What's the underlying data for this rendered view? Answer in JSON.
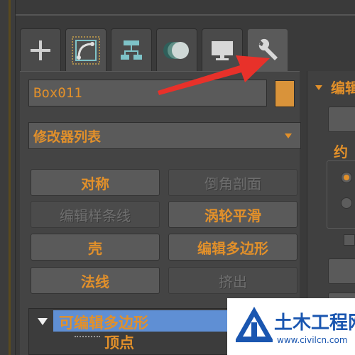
{
  "object_name": "Box011",
  "modifier_list_label": "修改器列表",
  "tabs": [
    {
      "name": "create-tab",
      "icon": "plus-icon"
    },
    {
      "name": "modify-tab",
      "icon": "modify-curve-icon"
    },
    {
      "name": "hierarchy-tab",
      "icon": "hierarchy-icon"
    },
    {
      "name": "motion-tab",
      "icon": "motion-circles-icon"
    },
    {
      "name": "display-tab",
      "icon": "monitor-icon"
    },
    {
      "name": "utilities-tab",
      "icon": "wrench-icon"
    }
  ],
  "modifier_buttons": [
    {
      "label": "对称",
      "enabled": true
    },
    {
      "label": "倒角剖面",
      "enabled": false
    },
    {
      "label": "编辑样条线",
      "enabled": false
    },
    {
      "label": "涡轮平滑",
      "enabled": true
    },
    {
      "label": "壳",
      "enabled": true
    },
    {
      "label": "编辑多边形",
      "enabled": true
    },
    {
      "label": "法线",
      "enabled": true
    },
    {
      "label": "挤出",
      "enabled": false
    }
  ],
  "stack": {
    "top_item": "可编辑多边形",
    "sub_item": "顶点"
  },
  "right_panel": {
    "rollout_title": "编辑",
    "label2": "约"
  },
  "watermark": {
    "title": "土木工程网",
    "url": "www.civilcn.com"
  },
  "colors": {
    "accent": "#e2902a",
    "swatch": "#d9933a",
    "highlight": "#5f8fd4",
    "arrow": "#e8312a"
  }
}
